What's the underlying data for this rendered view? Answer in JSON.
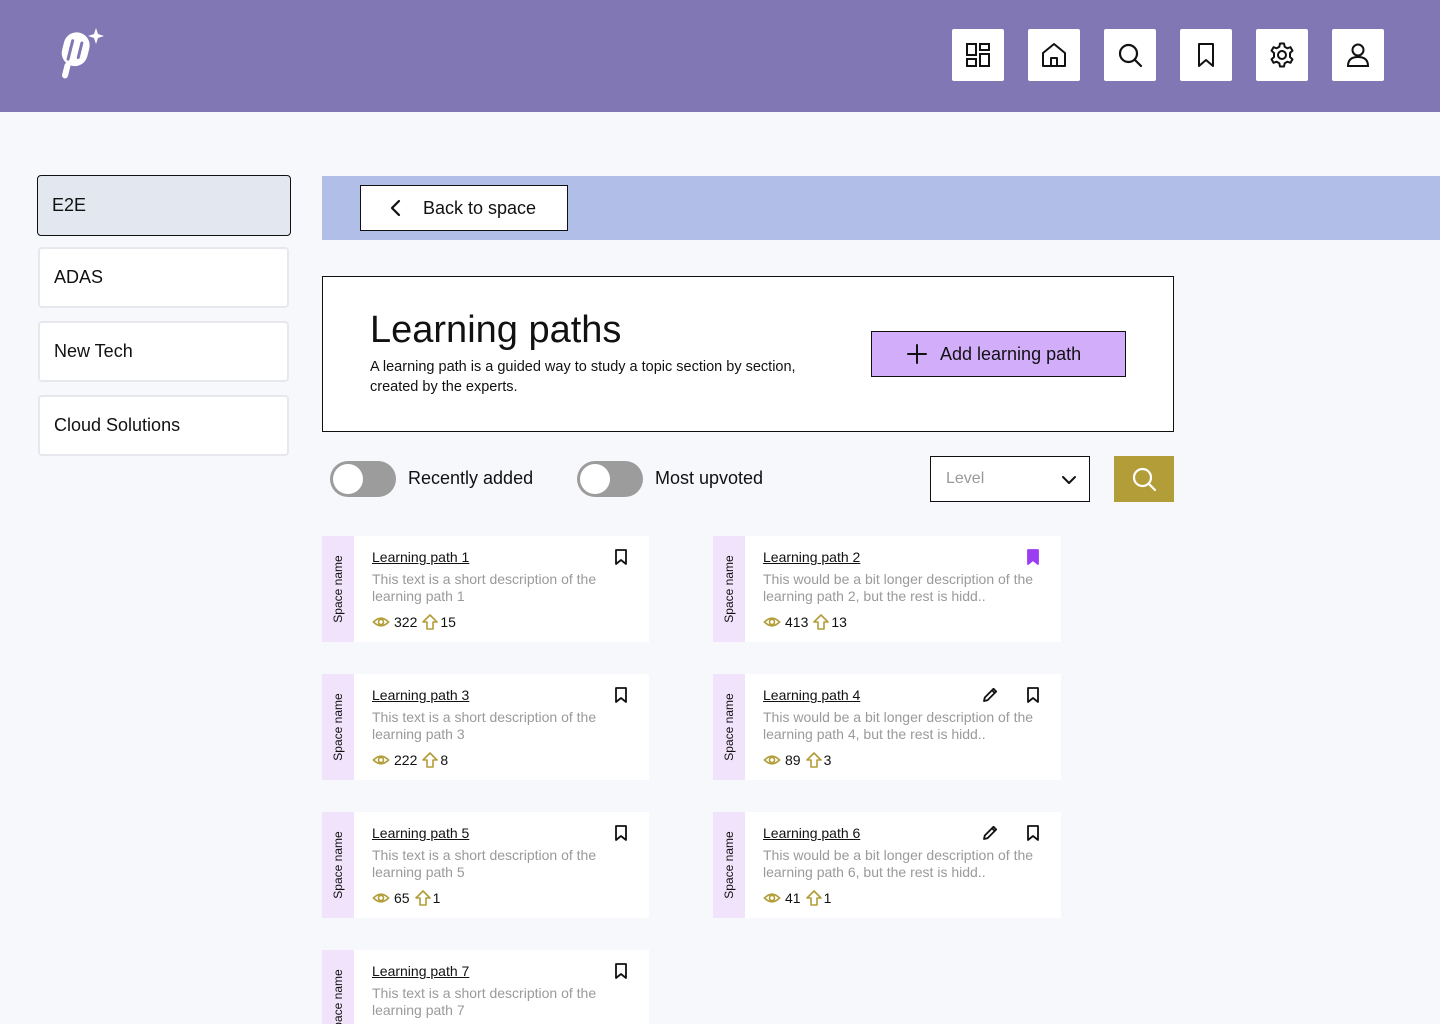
{
  "topbar": {
    "logo": "app-logo",
    "nav": [
      {
        "icon": "dashboard-icon"
      },
      {
        "icon": "home-icon"
      },
      {
        "icon": "search-icon"
      },
      {
        "icon": "bookmark-icon"
      },
      {
        "icon": "gear-icon"
      },
      {
        "icon": "user-icon"
      }
    ]
  },
  "sidebar": {
    "items": [
      {
        "label": "E2E",
        "active": true
      },
      {
        "label": "ADAS",
        "active": false
      },
      {
        "label": "New Tech",
        "active": false
      },
      {
        "label": "Cloud Solutions",
        "active": false
      }
    ]
  },
  "back": {
    "label": "Back to space"
  },
  "header": {
    "title": "Learning paths",
    "description": "A learning path is a guided way to study a topic section by section, created by the experts.",
    "add_label": "Add learning path"
  },
  "filters": {
    "recent_label": "Recently added",
    "upvoted_label": "Most upvoted",
    "level_placeholder": "Level"
  },
  "colors": {
    "topbar": "#8177b4",
    "accent_purple": "#9b3df0",
    "add_button": "#d2adfa",
    "search_button": "#b29d38",
    "strip": "#f2e3fc",
    "band": "#b1bfe8"
  },
  "cards": [
    {
      "space": "Space name",
      "title": "Learning path 1",
      "desc": "This text is a short description of the learning path 1",
      "views": "322",
      "votes": "15",
      "bookmarked": false,
      "editable": false
    },
    {
      "space": "Space name",
      "title": "Learning path 2",
      "desc": "This would be a bit longer description of the learning path 2, but the rest is hidd..",
      "views": "413",
      "votes": "13",
      "bookmarked": true,
      "editable": false
    },
    {
      "space": "Space name",
      "title": "Learning path 3",
      "desc": "This text is a short description of the learning path 3",
      "views": "222",
      "votes": "8",
      "bookmarked": false,
      "editable": false
    },
    {
      "space": "Space name",
      "title": "Learning path 4",
      "desc": "This would be a bit longer description of the learning path 4, but the rest is hidd..",
      "views": "89",
      "votes": "3",
      "bookmarked": false,
      "editable": true
    },
    {
      "space": "Space name",
      "title": "Learning path 5",
      "desc": "This text is a short description of the learning path 5",
      "views": "65",
      "votes": "1",
      "bookmarked": false,
      "editable": false
    },
    {
      "space": "Space name",
      "title": "Learning path 6",
      "desc": "This would be a bit longer description of the learning path 6, but the rest is hidd..",
      "views": "41",
      "votes": "1",
      "bookmarked": false,
      "editable": true
    },
    {
      "space": "Space name",
      "title": "Learning path 7",
      "desc": "This text is a short description of the learning path 7",
      "views": "",
      "votes": "",
      "bookmarked": false,
      "editable": false
    }
  ]
}
